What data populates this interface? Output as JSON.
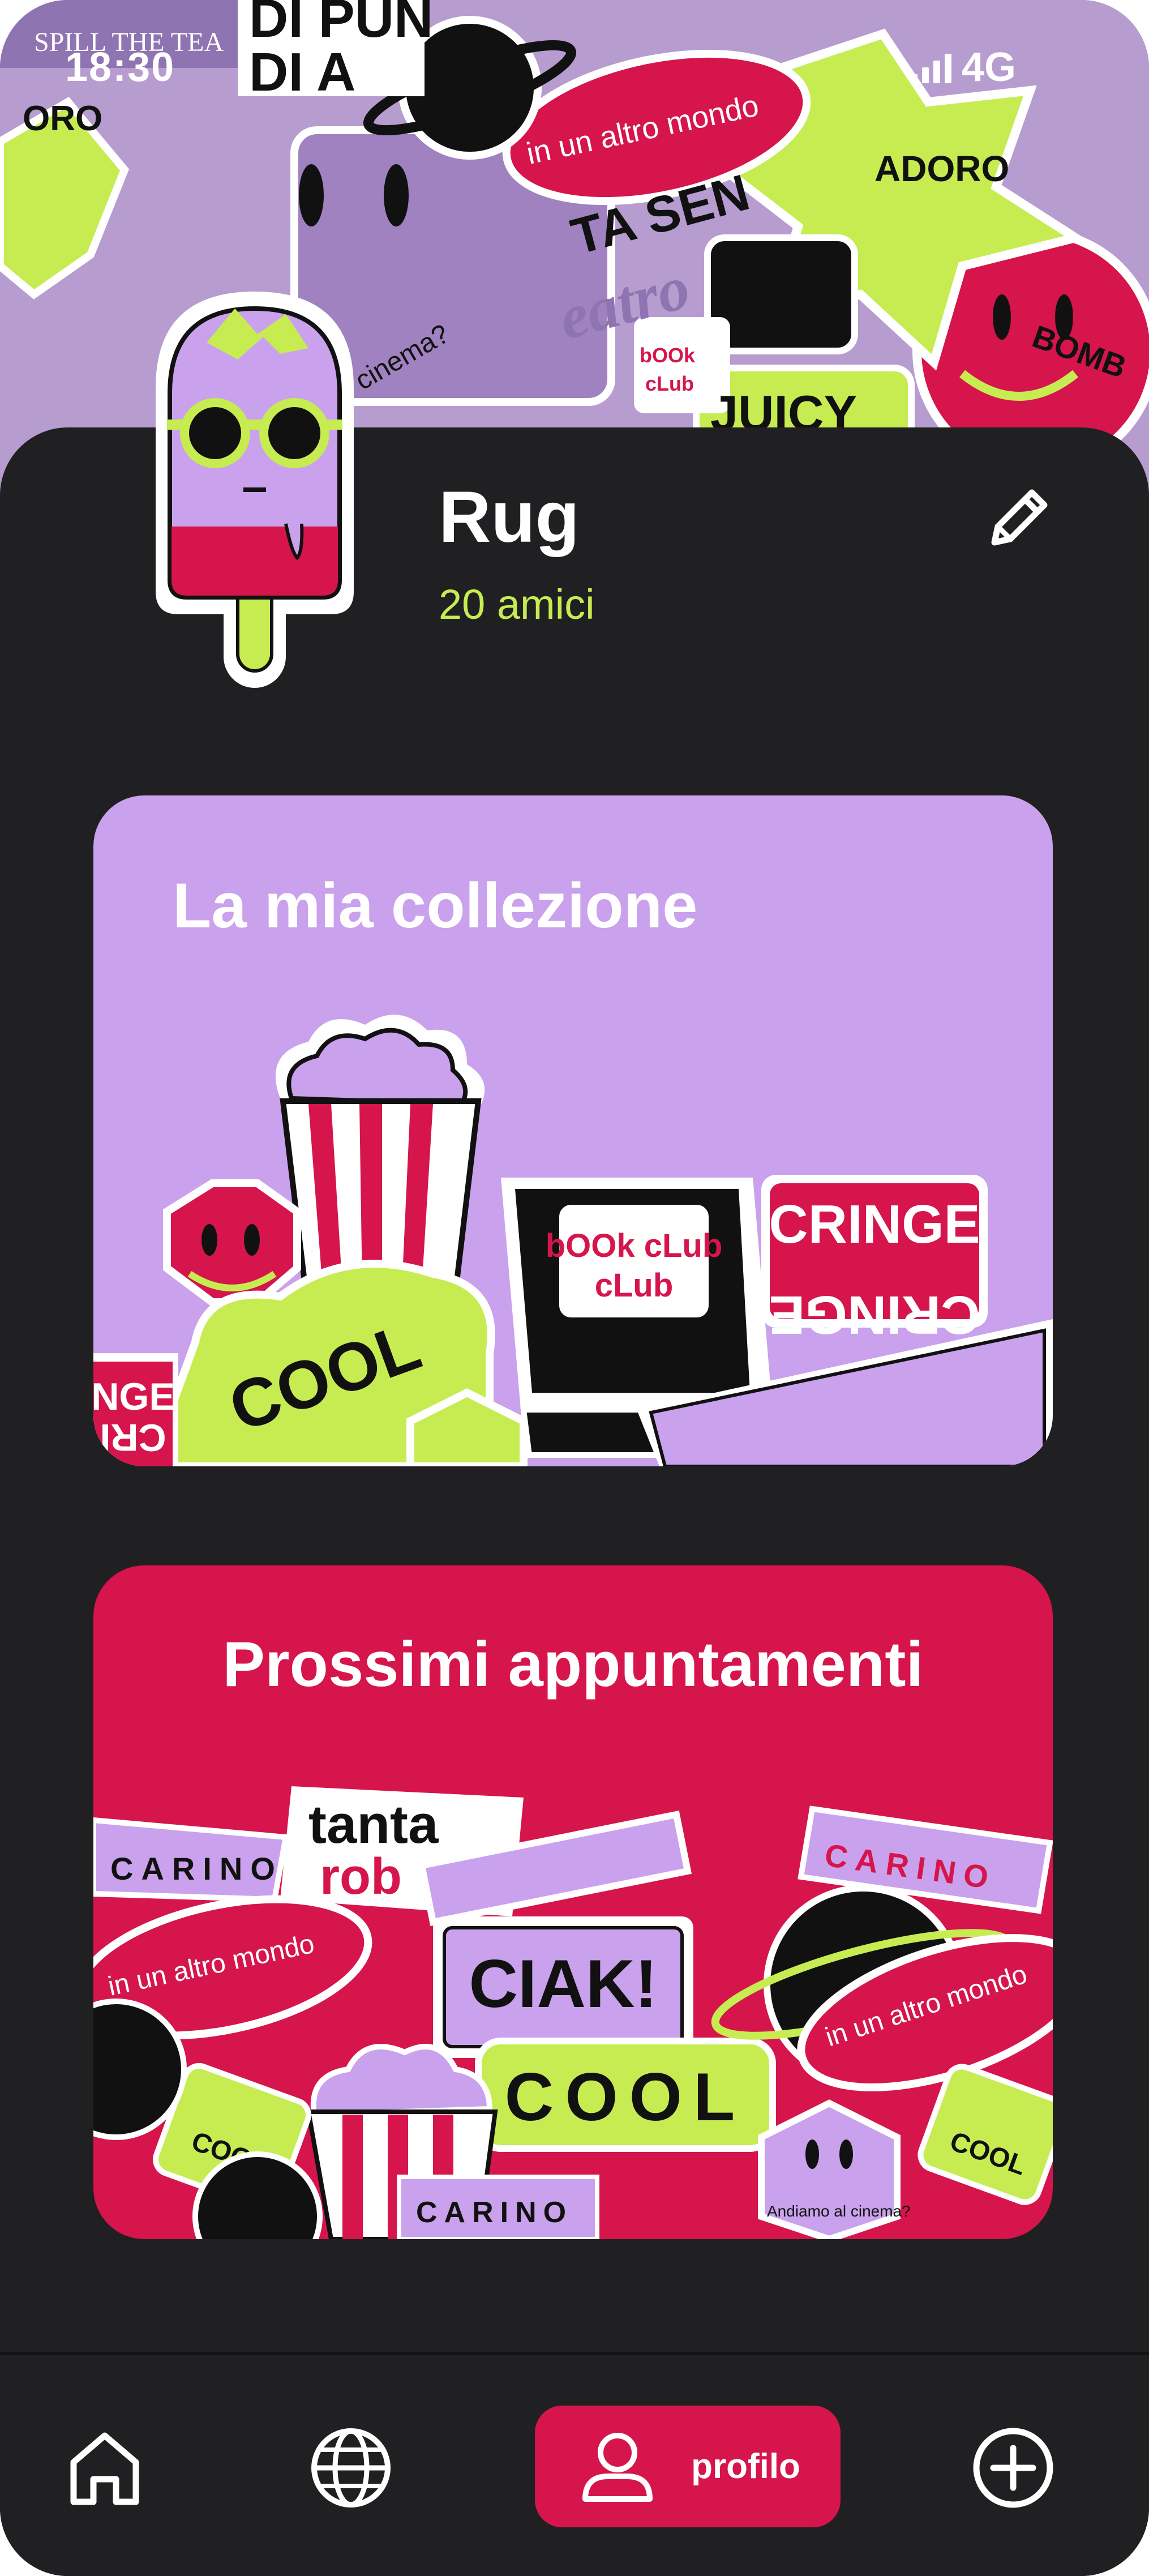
{
  "status_bar": {
    "time": "18:30",
    "network": "4G"
  },
  "hero": {
    "stickers": [
      "SPILL THE TEA",
      "DI PUN",
      "DI A",
      "in un altro mondo",
      "ORO",
      "ADORO",
      "eatro",
      "bOOk cLub",
      "JUICY",
      "cinema?",
      "TA SEN",
      "BOMB"
    ]
  },
  "profile": {
    "name": "Rug",
    "friends": "20 amici"
  },
  "cards": [
    {
      "title": "La mia collezione",
      "stickers": [
        "bOOk cLub",
        "CRINGE",
        "CRINGE",
        "COOL",
        "NGE",
        "CRI"
      ]
    },
    {
      "title": "Prossimi appuntamenti",
      "stickers": [
        "tanta",
        "rob",
        "CARINO",
        "CARINO",
        "CIAK!",
        "COOL",
        "in un altro mondo",
        "in un altro mondo",
        "CARINO",
        "COOL",
        "COOL",
        "Andiamo al cinema?"
      ]
    }
  ],
  "nav": {
    "profile_label": "profilo",
    "icons": [
      "home-icon",
      "globe-icon",
      "user-icon",
      "plus-circle-icon"
    ]
  },
  "colors": {
    "background": "#202022",
    "accent": "#d5154b",
    "lime": "#c6ec52",
    "lilac": "#caa1ec"
  }
}
